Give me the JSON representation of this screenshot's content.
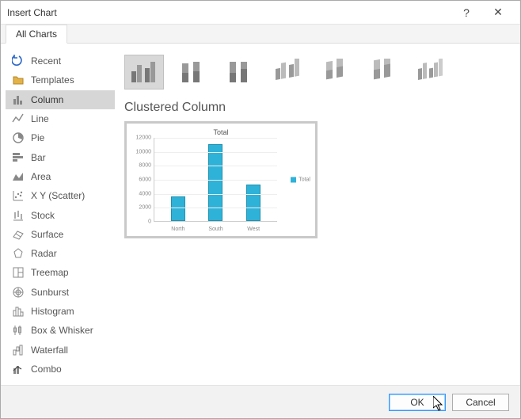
{
  "window": {
    "title": "Insert Chart",
    "help_label": "?",
    "close_label": "✕"
  },
  "tab": {
    "label": "All Charts"
  },
  "sidebar": {
    "items": [
      {
        "icon": "recent-icon",
        "label": "Recent"
      },
      {
        "icon": "templates-icon",
        "label": "Templates"
      },
      {
        "icon": "column-icon",
        "label": "Column",
        "selected": true
      },
      {
        "icon": "line-icon",
        "label": "Line"
      },
      {
        "icon": "pie-icon",
        "label": "Pie"
      },
      {
        "icon": "bar-icon",
        "label": "Bar"
      },
      {
        "icon": "area-icon",
        "label": "Area"
      },
      {
        "icon": "scatter-icon",
        "label": "X Y (Scatter)"
      },
      {
        "icon": "stock-icon",
        "label": "Stock"
      },
      {
        "icon": "surface-icon",
        "label": "Surface"
      },
      {
        "icon": "radar-icon",
        "label": "Radar"
      },
      {
        "icon": "treemap-icon",
        "label": "Treemap"
      },
      {
        "icon": "sunburst-icon",
        "label": "Sunburst"
      },
      {
        "icon": "histogram-icon",
        "label": "Histogram"
      },
      {
        "icon": "boxwhisker-icon",
        "label": "Box & Whisker"
      },
      {
        "icon": "waterfall-icon",
        "label": "Waterfall"
      },
      {
        "icon": "combo-icon",
        "label": "Combo"
      }
    ]
  },
  "subtypes": [
    {
      "name": "clustered-column",
      "selected": true
    },
    {
      "name": "stacked-column"
    },
    {
      "name": "percent-stacked-column"
    },
    {
      "name": "3d-clustered-column"
    },
    {
      "name": "3d-stacked-column"
    },
    {
      "name": "3d-percent-stacked-column"
    },
    {
      "name": "3d-column"
    }
  ],
  "subtitle": "Clustered Column",
  "chart_data": {
    "type": "bar",
    "title": "Total",
    "categories": [
      "North",
      "South",
      "West"
    ],
    "series": [
      {
        "name": "Total",
        "values": [
          3500,
          11000,
          5200
        ]
      }
    ],
    "yticks": [
      0,
      2000,
      4000,
      6000,
      8000,
      10000,
      12000
    ],
    "ylim": [
      0,
      12000
    ],
    "xlabel": "",
    "ylabel": ""
  },
  "buttons": {
    "ok": "OK",
    "cancel": "Cancel"
  }
}
